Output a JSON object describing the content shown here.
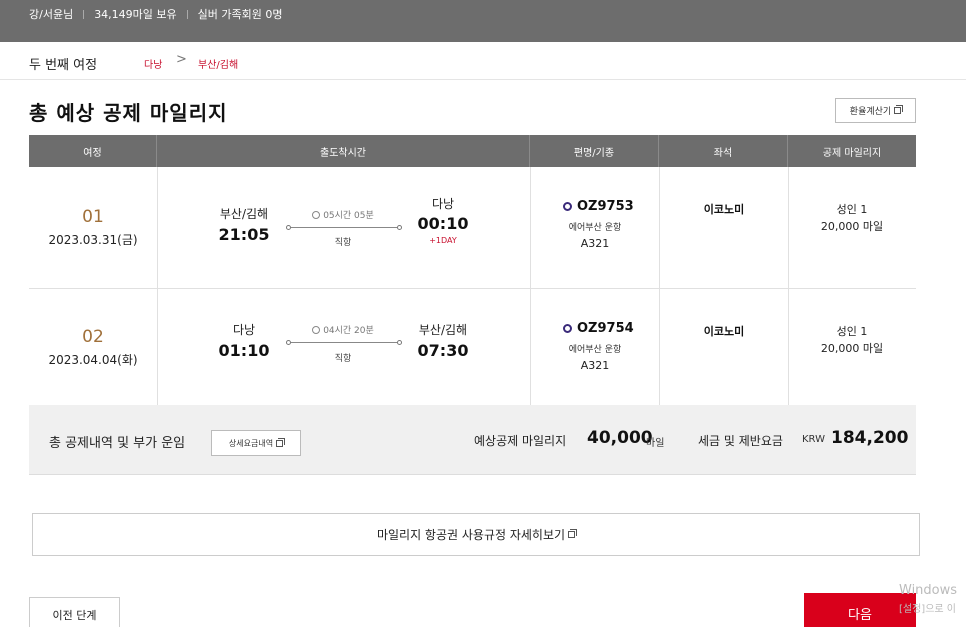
{
  "topbar": {
    "user": "강/서윤님",
    "miles": "34,149마일 보유",
    "tier": "실버 가족회원 0명"
  },
  "journey": {
    "label": "두 번째 여정",
    "from": "다낭",
    "arrow": ">",
    "to": "부산/김해"
  },
  "page": {
    "title": "총 예상 공제 마일리지",
    "calc_button": "환율계산기"
  },
  "table": {
    "headers": [
      "여정",
      "출도착시간",
      "편명/기종",
      "좌석",
      "공제 마일리지"
    ],
    "rows": [
      {
        "segment": "01",
        "date": "2023.03.31(금)",
        "dep_city": "부산/김해",
        "dep_time": "21:05",
        "duration": "05시간 05분",
        "stops": "직항",
        "arr_city": "다낭",
        "arr_time": "00:10",
        "plus_day": "+1DAY",
        "flight_no": "OZ9753",
        "operated_by": "에어부산 운항",
        "aircraft": "A321",
        "cabin": "이코노미",
        "passengers": "성인 1",
        "miles": "20,000 마일"
      },
      {
        "segment": "02",
        "date": "2023.04.04(화)",
        "dep_city": "다낭",
        "dep_time": "01:10",
        "duration": "04시간 20분",
        "stops": "직항",
        "arr_city": "부산/김해",
        "arr_time": "07:30",
        "plus_day": "",
        "flight_no": "OZ9754",
        "operated_by": "에어부산 운항",
        "aircraft": "A321",
        "cabin": "이코노미",
        "passengers": "성인 1",
        "miles": "20,000 마일"
      }
    ]
  },
  "summary": {
    "label": "총 공제내역 및 부가 운임",
    "detail_button": "상세요금내역",
    "est_label": "예상공제 마일리지",
    "est_value": "40,000",
    "est_unit": "마일",
    "tax_label": "세금 및 제반요금",
    "tax_currency": "KRW",
    "tax_value": "184,200"
  },
  "rules_button": "마일리지 항공권 사용규정 자세히보기",
  "nav": {
    "prev": "이전 단계",
    "next": "다음"
  },
  "watermark": {
    "line1": "Windows",
    "line2": "[설정]으로 이"
  }
}
